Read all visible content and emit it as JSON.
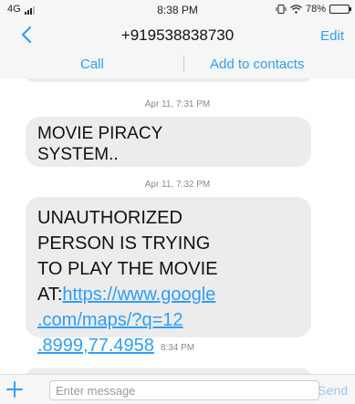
{
  "status_bar": {
    "network": "4G",
    "time": "8:38 PM",
    "battery_percent_text": "78%",
    "battery_level": 0.78,
    "icons": [
      "signal-icon",
      "vibrate-icon",
      "wifi-icon",
      "battery-icon"
    ]
  },
  "nav": {
    "back_icon": "chevron-left-icon",
    "title": "+919538838730",
    "edit_label": "Edit"
  },
  "actions": {
    "call_label": "Call",
    "add_contact_label": "Add to contacts"
  },
  "messages": [
    {
      "timestamp": "Apr 11, 7:31 PM",
      "lines": [
        "MOVIE PIRACY",
        "SYSTEM.."
      ]
    },
    {
      "timestamp": "Apr 11, 7:32 PM",
      "lines": [
        "UNAUTHORIZED",
        "PERSON IS TRYING",
        "TO PLAY THE MOVIE"
      ],
      "prefix": "AT:",
      "link_lines": [
        "https://www.google",
        ".com/maps/?q=12",
        ".8999,77.4958"
      ]
    },
    {
      "timestamp": "8:34 PM"
    }
  ],
  "composer": {
    "add_icon": "plus-icon",
    "placeholder": "Enter message",
    "value": "",
    "send_label": "Send"
  },
  "colors": {
    "accent": "#2f9ef4",
    "bubble": "#ececec",
    "bar_background": "#f6f6f6",
    "send_disabled": "#9cc9ee"
  }
}
